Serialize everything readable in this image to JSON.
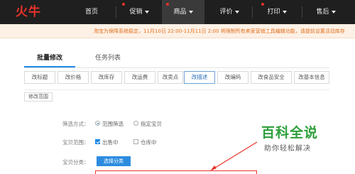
{
  "nav": {
    "logo": "火牛",
    "items": [
      {
        "label": "首页",
        "caret": false,
        "dot": false,
        "active": false
      },
      {
        "label": "促销",
        "caret": true,
        "dot": true,
        "active": false
      },
      {
        "label": "商品",
        "caret": true,
        "dot": true,
        "active": true
      },
      {
        "label": "评价",
        "caret": true,
        "dot": false,
        "active": false
      },
      {
        "label": "打印",
        "caret": true,
        "dot": true,
        "active": false
      },
      {
        "label": "售后",
        "caret": true,
        "dot": false,
        "active": false
      }
    ]
  },
  "notice": {
    "text": "淘宝为保障系统稳定，11月10日 22:00-11月11日 2:00 将限制所有卖家营销工具编辑功能，请提前设置活动库存",
    "color": "#e0701e"
  },
  "tabs": [
    {
      "label": "批量修改",
      "active": true
    },
    {
      "label": "任务列表",
      "active": false
    }
  ],
  "sub_buttons": [
    {
      "label": "改标题",
      "active": false
    },
    {
      "label": "改价格",
      "active": false
    },
    {
      "label": "改库存",
      "active": false
    },
    {
      "label": "改运费",
      "active": false
    },
    {
      "label": "改卖点",
      "active": false
    },
    {
      "label": "改描述",
      "active": true
    },
    {
      "label": "改编码",
      "active": false
    },
    {
      "label": "改食品安全",
      "active": false
    },
    {
      "label": "改基本信息",
      "active": false
    }
  ],
  "scope": {
    "section_title": "修改范围",
    "filter_label": "筛选方式：",
    "filter_options": [
      {
        "label": "范围筛选",
        "checked": true
      },
      {
        "label": "指定宝贝",
        "checked": false
      }
    ],
    "range_label": "宝贝范围：",
    "range_options": [
      {
        "label": "出售中",
        "checked": true
      },
      {
        "label": "仓库中",
        "checked": false
      }
    ],
    "category_label": "宝贝分类：",
    "category_button": "选择分类"
  },
  "watermark": {
    "title": "百科全说",
    "subtitle": "助你轻松解决"
  },
  "colors": {
    "accent": "#1e88e5",
    "brand_red": "#e8332a",
    "brand_green": "#2d9f3a"
  }
}
